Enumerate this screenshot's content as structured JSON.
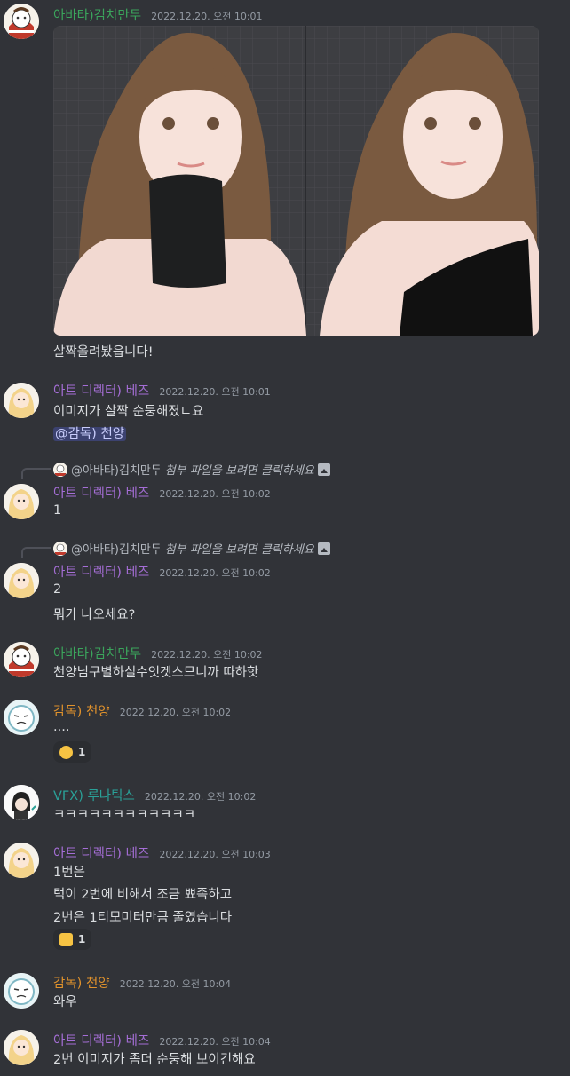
{
  "messages": [
    {
      "name": "아바타)김치만두",
      "time": "2022.12.20. 오전 10:01",
      "lines": [
        "살짝올려봤읍니다!"
      ]
    },
    {
      "name": "아트 디렉터) 베즈",
      "time": "2022.12.20. 오전 10:01",
      "lines": [
        "이미지가 살짝 순둥해졌ㄴ요"
      ],
      "mention": "@감독) 천양"
    },
    {
      "reply_name": "@아바타)김치만두",
      "reply_text": "첨부 파일을 보려면 클릭하세요",
      "name": "아트 디렉터) 베즈",
      "time": "2022.12.20. 오전 10:02",
      "lines": [
        "1"
      ]
    },
    {
      "reply_name": "@아바타)김치만두",
      "reply_text": "첨부 파일을 보려면 클릭하세요",
      "name": "아트 디렉터) 베즈",
      "time": "2022.12.20. 오전 10:02",
      "lines": [
        "2",
        "뭐가 나오세요?"
      ]
    },
    {
      "name": "아바타)김치만두",
      "time": "2022.12.20. 오전 10:02",
      "lines": [
        "천양님구별하실수잇겟스므니까 따하핫"
      ]
    },
    {
      "name": "감독) 천양",
      "time": "2022.12.20. 오전 10:02",
      "lines": [
        "...."
      ],
      "reaction_count": "1"
    },
    {
      "name": "VFX) 루나틱스",
      "time": "2022.12.20. 오전 10:02",
      "lines": [
        "ㅋㅋㅋㅋㅋㅋㅋㅋㅋㅋㅋㅋ"
      ]
    },
    {
      "name": "아트 디렉터) 베즈",
      "time": "2022.12.20. 오전 10:03",
      "lines": [
        "1번은",
        "턱이 2번에 비해서 조금 뾰족하고",
        "2번은 1티모미터만큼 줄였습니다"
      ],
      "reaction_count": "1"
    },
    {
      "name": "감독) 천양",
      "time": "2022.12.20. 오전 10:04",
      "lines": [
        "와우"
      ]
    },
    {
      "name": "아트 디렉터) 베즈",
      "time": "2022.12.20. 오전 10:04",
      "lines": [
        "2번 이미지가 좀더 순둥해 보이긴해요"
      ]
    }
  ],
  "colors": {
    "kimchi": "#3ba55c",
    "bez": "#a56ed6",
    "cheonyang": "#e0922c",
    "lunatics": "#2aa198",
    "bg": "#313338"
  }
}
